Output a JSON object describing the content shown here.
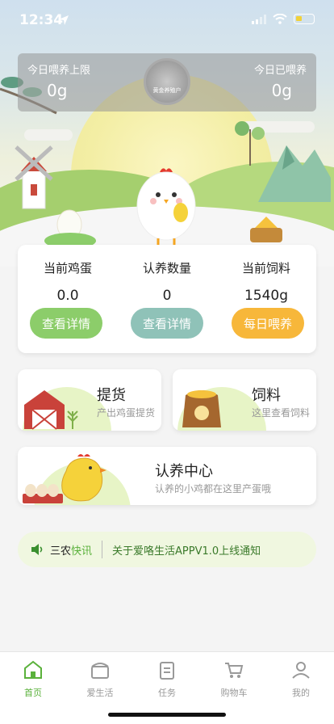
{
  "status": {
    "time": "12:34"
  },
  "header": {
    "left_label": "今日喂养上限",
    "left_value": "0g",
    "right_label": "今日已喂养",
    "right_value": "0g",
    "badge_text": "黄金养殖户"
  },
  "stats": [
    {
      "title": "当前鸡蛋",
      "value": "0.0",
      "button": "查看详情",
      "color": "#8ccd6a"
    },
    {
      "title": "认养数量",
      "value": "0",
      "button": "查看详情",
      "color": "#8fc2b8"
    },
    {
      "title": "当前饲料",
      "value": "1540g",
      "button": "每日喂养",
      "color": "#f7b73a"
    }
  ],
  "features": {
    "pickup": {
      "title": "提货",
      "sub": "产出鸡蛋提货"
    },
    "feed": {
      "title": "饲料",
      "sub": "这里查看饲料"
    },
    "adopt": {
      "title": "认养中心",
      "sub": "认养的小鸡都在这里产蛋哦"
    }
  },
  "notice": {
    "tag_a": "三农",
    "tag_b": "快讯",
    "text": "关于爱咯生活APPV1.0上线通知"
  },
  "tabs": [
    {
      "label": "首页",
      "icon": "home-icon"
    },
    {
      "label": "爱生活",
      "icon": "store-icon"
    },
    {
      "label": "任务",
      "icon": "task-icon"
    },
    {
      "label": "购物车",
      "icon": "cart-icon"
    },
    {
      "label": "我的",
      "icon": "profile-icon"
    }
  ],
  "colors": {
    "accent": "#5ab13b",
    "tab_inactive": "#999999"
  }
}
